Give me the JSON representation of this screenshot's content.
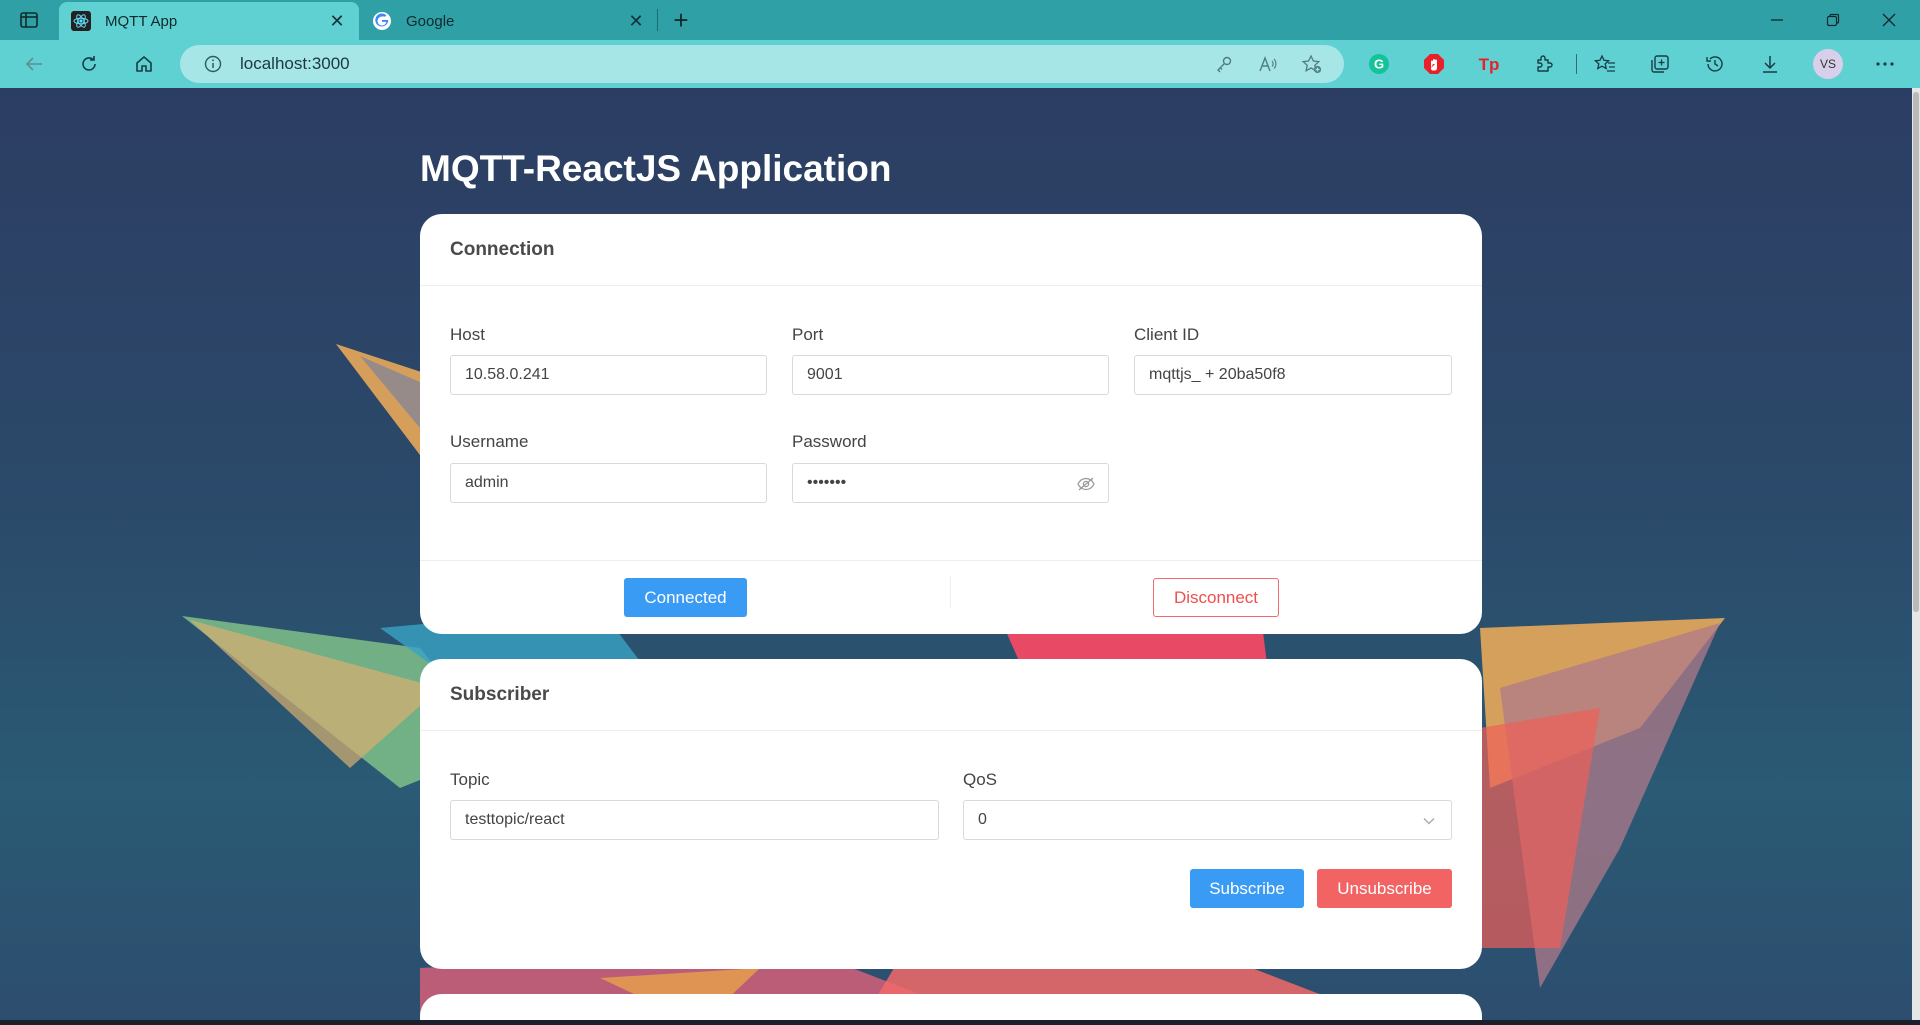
{
  "browser": {
    "tabs": [
      {
        "title": "MQTT App",
        "icon": "react-icon",
        "active": true
      },
      {
        "title": "Google",
        "icon": "google-icon",
        "active": false
      }
    ],
    "url": "localhost:3000",
    "profile_initials": "VS",
    "accent_color": "#2fa0a6"
  },
  "app": {
    "title": "MQTT-ReactJS Application"
  },
  "connection": {
    "header": "Connection",
    "host_label": "Host",
    "host_value": "10.58.0.241",
    "port_label": "Port",
    "port_value": "9001",
    "client_id_label": "Client ID",
    "client_id_value": "mqttjs_ + 20ba50f8",
    "username_label": "Username",
    "username_value": "admin",
    "password_label": "Password",
    "password_value": "•••••••",
    "connect_button": "Connected",
    "disconnect_button": "Disconnect"
  },
  "subscriber": {
    "header": "Subscriber",
    "topic_label": "Topic",
    "topic_value": "testtopic/react",
    "qos_label": "QoS",
    "qos_value": "0",
    "subscribe_button": "Subscribe",
    "unsubscribe_button": "Unsubscribe"
  },
  "colors": {
    "primary": "#3a9bf5",
    "danger": "#f26363"
  }
}
